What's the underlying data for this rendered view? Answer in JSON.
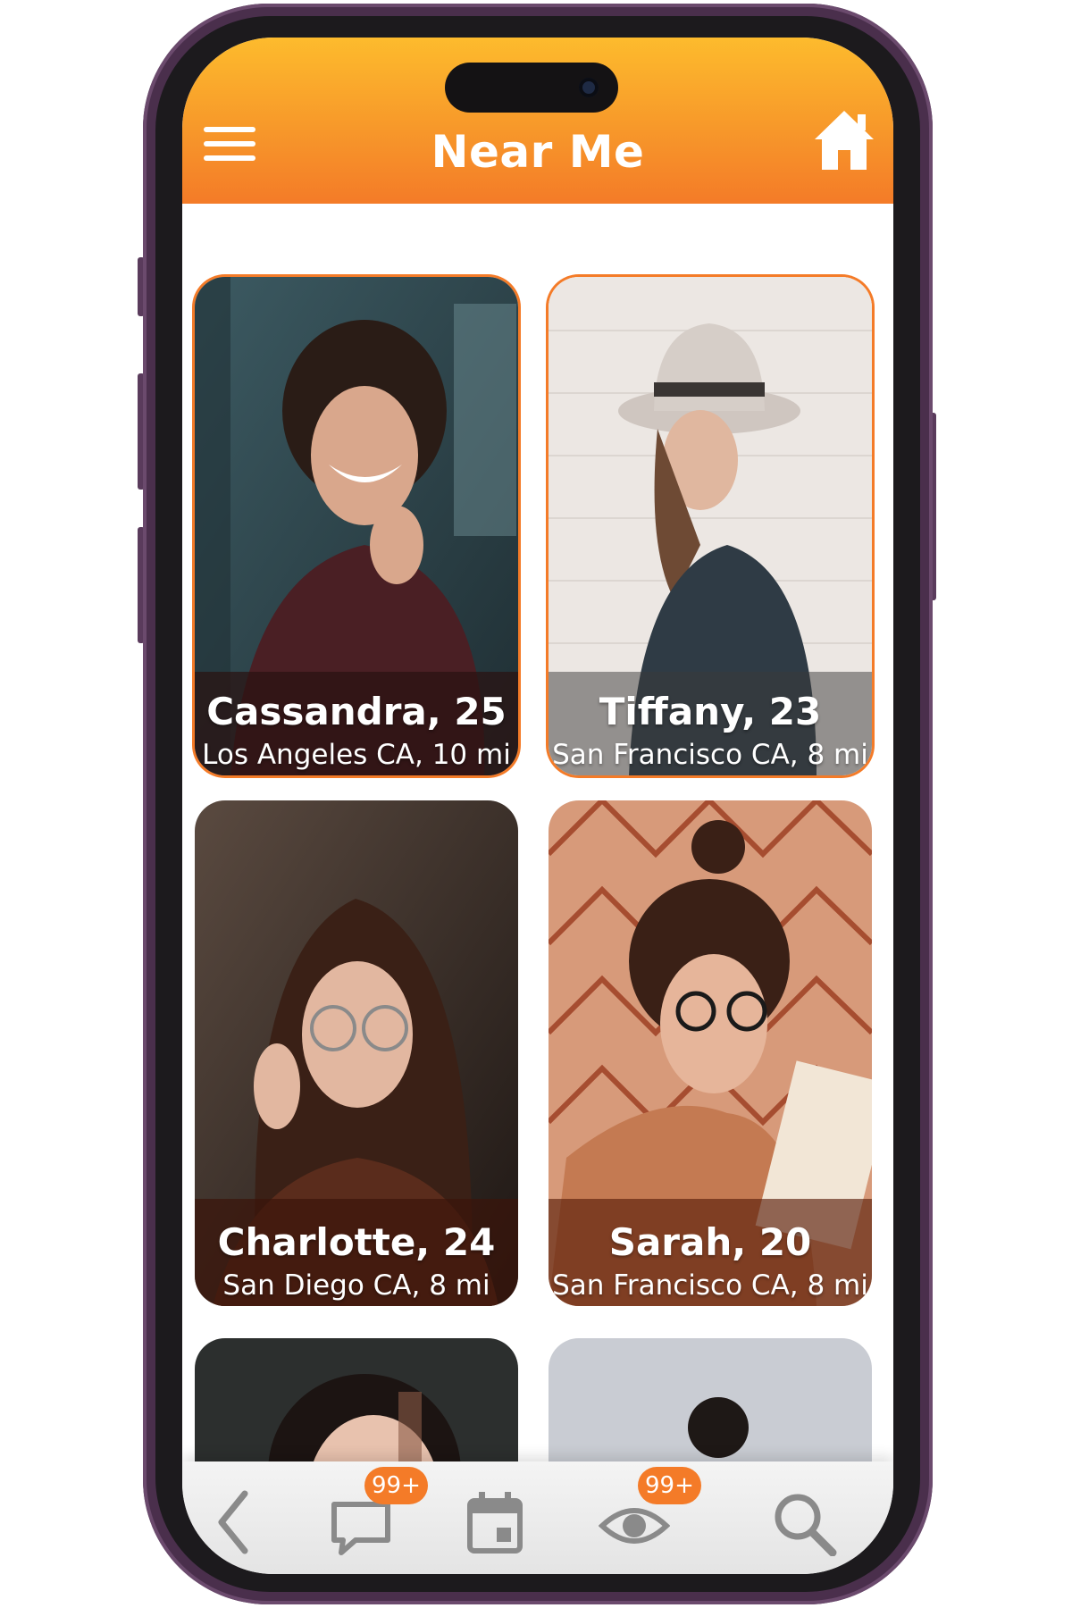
{
  "header": {
    "title": "Near Me",
    "menu_icon": "hamburger-menu-icon",
    "home_icon": "home-icon",
    "gradient": [
      "#fdbb2d",
      "#f47b28"
    ]
  },
  "profiles": [
    {
      "name_age": "Cassandra, 25",
      "location": "Los Angeles CA, 10 mi",
      "selected": true
    },
    {
      "name_age": "Tiffany, 23",
      "location": "San Francisco CA, 8 mi",
      "selected": true
    },
    {
      "name_age": "Charlotte, 24",
      "location": "San Diego CA, 8 mi",
      "selected": false
    },
    {
      "name_age": "Sarah, 20",
      "location": "San Francisco CA, 8 mi",
      "selected": false
    },
    {
      "name_age": "",
      "location": ""
    },
    {
      "name_age": "",
      "location": ""
    }
  ],
  "bottom_nav": {
    "items": [
      {
        "icon": "chevron-left-icon"
      },
      {
        "icon": "chat-icon",
        "badge": "99+"
      },
      {
        "icon": "calendar-icon"
      },
      {
        "icon": "eye-icon",
        "badge": "99+"
      },
      {
        "icon": "search-icon"
      }
    ]
  },
  "colors": {
    "accent": "#f47b28",
    "badge": "#f47b28",
    "nav_icon": "#8a8a8a"
  }
}
